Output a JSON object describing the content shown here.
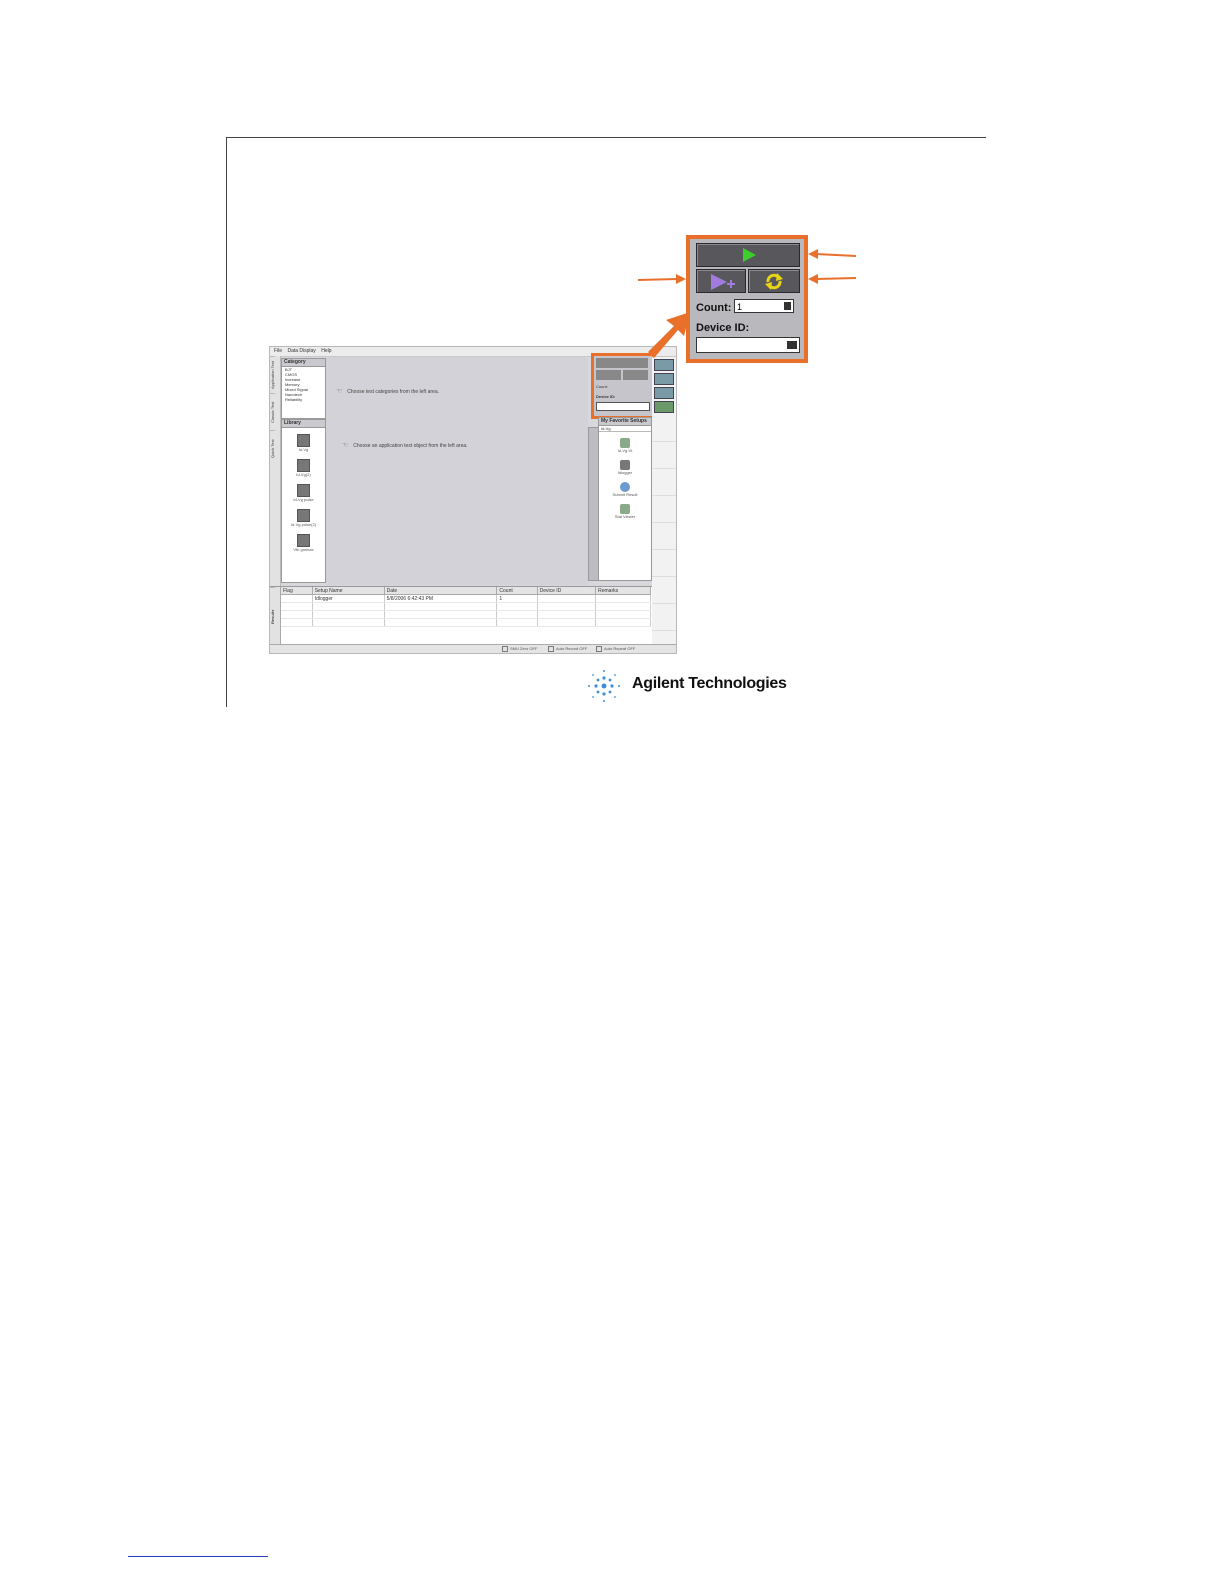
{
  "menu": {
    "items": [
      "File",
      "Data Display",
      "Help"
    ]
  },
  "left_tabs": [
    "Application Test",
    "Classic Test",
    "Quick Test"
  ],
  "category": {
    "title": "Category",
    "items": [
      "BJT",
      "CMOS",
      "Increase",
      "Memory",
      "Mixed Signal",
      "Nanotech",
      "Reliability"
    ]
  },
  "library": {
    "title": "Library",
    "items": [
      "Id-Vg",
      "Id-Vg(2)",
      "Id-Vg pulse",
      "Id-Vg pulse(2)",
      "Vth gmmax"
    ]
  },
  "main": {
    "hint1": "Choose test categories from the left area.",
    "hint2": "Choose an application test object from the left area."
  },
  "favorite": {
    "title": "My Favorite Setups",
    "filter": "Id-Vg",
    "items": [
      "Id-Vg-Vt",
      "Idlogger",
      "Submit Result",
      "Stat Viewer"
    ]
  },
  "results": {
    "tab": "Results",
    "columns": [
      "Flag",
      "Setup Name",
      "Date",
      "Count",
      "Device ID",
      "Remarks"
    ],
    "rows": [
      [
        "",
        "Idlogger",
        "5/8/2006 6:42:43 PM",
        "1",
        "",
        ""
      ]
    ]
  },
  "status": [
    "SMU Zero OFF",
    "Auto Record OFF",
    "Auto Repeat OFF"
  ],
  "control_panel": {
    "count_label": "Count:",
    "count_value": "1",
    "device_id_label": "Device ID:",
    "device_id_value": "",
    "icons": {
      "run": "play-icon",
      "append": "append-run-icon",
      "repeat": "repeat-icon"
    }
  },
  "logo": {
    "text": "Agilent Technologies"
  },
  "colors": {
    "callout": "#e8702a",
    "run": "#3ccf2a",
    "append": "#a27be0",
    "repeat": "#e8d414"
  }
}
